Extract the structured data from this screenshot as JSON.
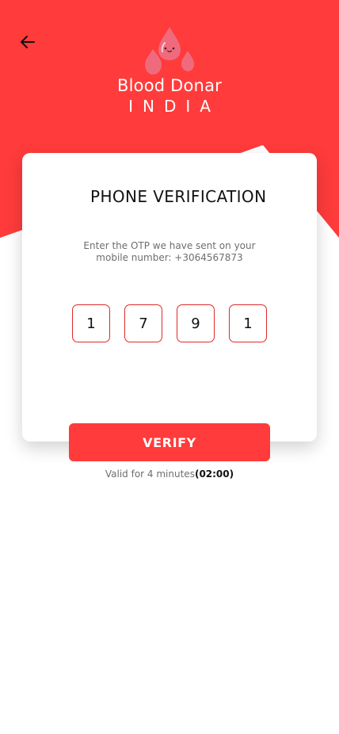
{
  "colors": {
    "brand_red": "#ff3b3b",
    "otp_border": "#e02a2a",
    "text_dark": "#111111",
    "text_muted": "#6e6e6e",
    "logo_pink": "#f06a7d"
  },
  "header": {
    "back_icon": "arrow-left-icon",
    "logo_icon": "blood-drop-logo-icon",
    "app_name": "Blood Donar",
    "app_subtitle": "INDIA"
  },
  "card": {
    "title": "PHONE VERIFICATION",
    "description_line1": "Enter the OTP we have sent on your",
    "description_line2": "mobile number: +3064567873",
    "otp_digits": [
      "1",
      "7",
      "9",
      "1"
    ]
  },
  "actions": {
    "verify_label": "VERIFY"
  },
  "validity": {
    "text": "Valid for 4 minutes",
    "timer": "(02:00)"
  }
}
